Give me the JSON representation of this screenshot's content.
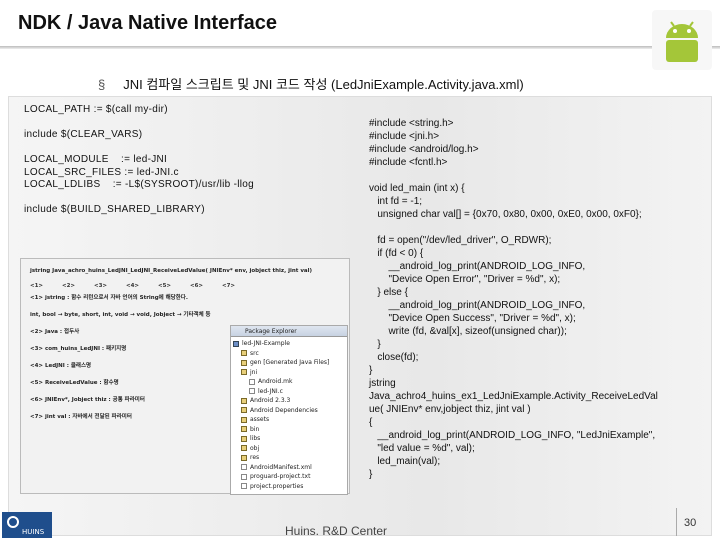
{
  "slide": {
    "title": "NDK / Java Native Interface",
    "subtitle_bullet": "§",
    "subtitle": "JNI 컴파일 스크립트 및 JNI 코드 작성 (LedJniExample.Activity.java.xml)",
    "footer": "Huins. R&D Center",
    "page_number": "30",
    "footer_logo_text": "HUINS"
  },
  "makefile_lines": [
    "LOCAL_PATH := $(call my-dir)",
    "",
    "include $(CLEAR_VARS)",
    "",
    "LOCAL_MODULE    := led-JNI",
    "LOCAL_SRC_FILES := led-JNI.c",
    "LOCAL_LDLIBS    := -L$(SYSROOT)/usr/lib -llog",
    "",
    "include $(BUILD_SHARED_LIBRARY)"
  ],
  "c_code_lines": [
    "#include <string.h>",
    "#include <jni.h>",
    "#include <android/log.h>",
    "#include <fcntl.h>",
    "",
    "void led_main (int x) {",
    "   int fd = -1;",
    "   unsigned char val[] = {0x70, 0x80, 0x00, 0xE0, 0x00, 0xF0};",
    "",
    "   fd = open(\"/dev/led_driver\", O_RDWR);",
    "   if (fd < 0) {",
    "       __android_log_print(ANDROID_LOG_INFO,",
    "       \"Device Open Error\", \"Driver = %d\", x);",
    "   } else {",
    "       __android_log_print(ANDROID_LOG_INFO,",
    "       \"Device Open Success\", \"Driver = %d\", x);",
    "       write (fd, &val[x], sizeof(unsigned char));",
    "   }",
    "   close(fd);",
    "}",
    "jstring",
    "Java_achro4_huins_ex1_LedJniExample.Activity_ReceiveLedVal",
    "ue( JNIEnv* env,jobject thiz, jint val )",
    "{",
    "   __android_log_print(ANDROID_LOG_INFO, \"LedJniExample\",",
    "   \"led value = %d\", val);",
    "   led_main(val);",
    "}"
  ],
  "screenshot": {
    "signature": "jstring Java_achro_huins_LedJNI_LedJNI_ReceiveLedValue( JNIEnv* env, jobject thiz, jint val)",
    "header_cells": [
      "<1>",
      "<2>",
      "<3>",
      "<4>",
      "<5>",
      "<6>",
      "<7>"
    ],
    "notes": [
      "<1> jstring : 함수 리턴으로서 자바 언어의 String에 해당한다.",
      "       int, bool → byte, short, int, void → void, Jobject → 기타객체 등",
      "<2> Java : 접두사",
      "<3> com_huins_LedJNI : 패키지명",
      "<4> LedJNI : 클래스명",
      "<5> ReceiveLedValue : 함수명",
      "<6> JNIEnv*, Jobject thiz : 공통 파라미터",
      "<7> jint val : 자바에서 전달된 파라미터"
    ],
    "package_explorer_title": "Package Explorer",
    "tree_items": [
      {
        "label": "led-JNI-Example",
        "kind": "proj"
      },
      {
        "label": "src",
        "kind": "folder"
      },
      {
        "label": "gen [Generated Java Files]",
        "kind": "folder"
      },
      {
        "label": "jni",
        "kind": "folder"
      },
      {
        "label": "Android.mk",
        "kind": "file"
      },
      {
        "label": "led-JNI.c",
        "kind": "file"
      },
      {
        "label": "Android 2.3.3",
        "kind": "folder"
      },
      {
        "label": "Android Dependencies",
        "kind": "folder"
      },
      {
        "label": "assets",
        "kind": "folder"
      },
      {
        "label": "bin",
        "kind": "folder"
      },
      {
        "label": "libs",
        "kind": "folder"
      },
      {
        "label": "obj",
        "kind": "folder"
      },
      {
        "label": "res",
        "kind": "folder"
      },
      {
        "label": "AndroidManifest.xml",
        "kind": "file"
      },
      {
        "label": "proguard-project.txt",
        "kind": "file"
      },
      {
        "label": "project.properties",
        "kind": "file"
      }
    ]
  }
}
